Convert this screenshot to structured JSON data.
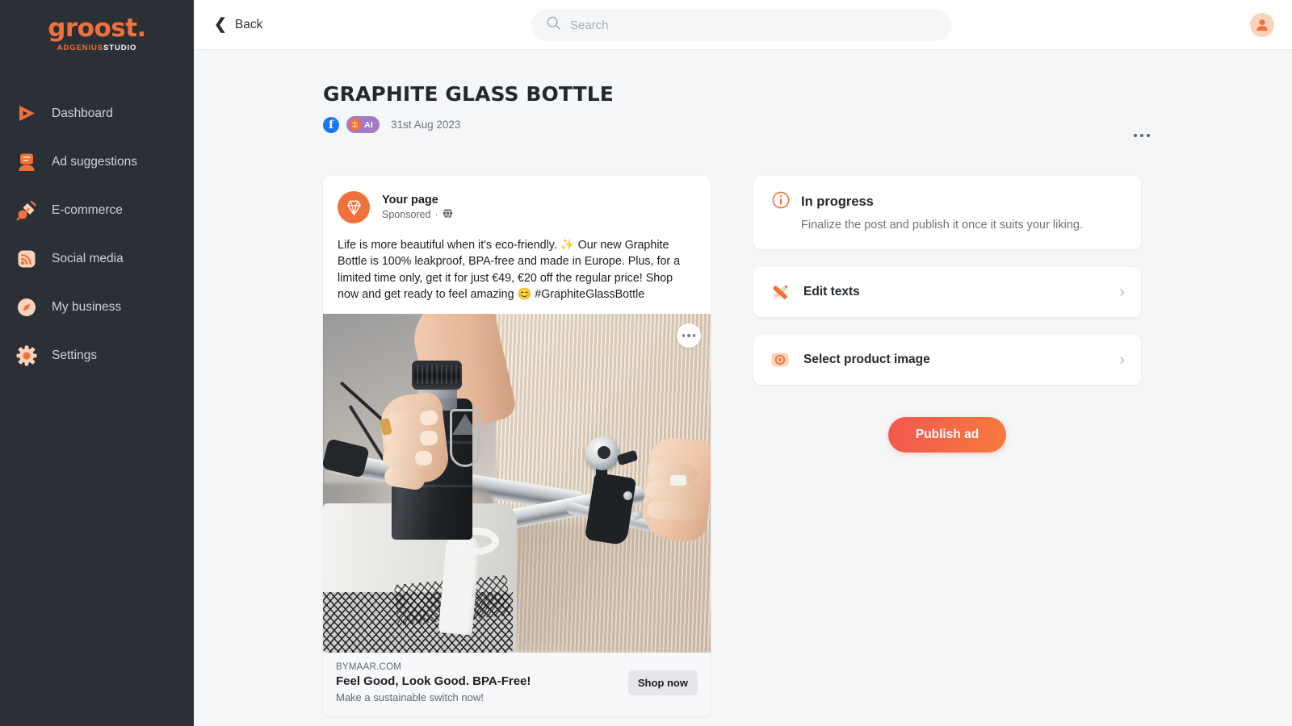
{
  "brand": {
    "logo_word": "groost.",
    "logo_sub_orange": "ADGENIUS",
    "logo_sub_white": "STUDIO"
  },
  "colors": {
    "accent": "#f2713a",
    "sidebar_bg": "#2b2f36",
    "page_bg": "#f5f6f8",
    "publish_gradient_start": "#f2584f",
    "publish_gradient_end": "#f87a3c",
    "ai_badge_bg": "#a27bc4",
    "facebook_blue": "#1877f2",
    "shop_btn_bg": "#e4e6eb"
  },
  "sidebar": {
    "items": [
      {
        "label": "Dashboard",
        "icon": "play-triangle-icon"
      },
      {
        "label": "Ad suggestions",
        "icon": "ad-card-icon"
      },
      {
        "label": "E-commerce",
        "icon": "plug-icon"
      },
      {
        "label": "Social media",
        "icon": "rss-icon"
      },
      {
        "label": "My business",
        "icon": "compass-icon"
      },
      {
        "label": "Settings",
        "icon": "gear-icon"
      }
    ]
  },
  "topbar": {
    "back_label": "Back",
    "back_icon": "chevron-left-icon",
    "search_placeholder": "Search",
    "search_value": "",
    "search_icon": "search-icon",
    "avatar_icon": "user-avatar-icon"
  },
  "page": {
    "title": "GRAPHITE GLASS BOTTLE",
    "platform_badge": "f",
    "platform_name": "facebook-icon",
    "ai_badge_label": "AI",
    "ai_badge_icon": "brain-icon",
    "date": "31st Aug 2023",
    "overflow_menu_icon": "more-horizontal-icon"
  },
  "post": {
    "page_name": "Your page",
    "sponsored": "Sponsored",
    "separator": "·",
    "audience_icon": "globe-icon",
    "avatar_icon": "diamond-icon",
    "body": "Life is more beautiful when it's eco-friendly. ✨ Our new Graphite Bottle is 100% leakproof, BPA-free and made in Europe. Plus, for a limited time only, get it for just €49, €20 off the regular price! Shop now and get ready to feel amazing 😊 #GraphiteGlassBottle",
    "image_alt": "Woman placing a black graphite glass bottle into a white bicycle basket",
    "image_menu_icon": "more-horizontal-icon",
    "link_domain": "BYMAAR.COM",
    "link_title": "Feel Good, Look Good. BPA-Free!",
    "link_description": "Make a sustainable switch now!",
    "cta_label": "Shop now"
  },
  "status": {
    "icon": "info-circle-icon",
    "title": "In progress",
    "description": "Finalize the post and publish it once it suits your liking."
  },
  "actions": [
    {
      "label": "Edit texts",
      "icon": "pencil-cross-icon",
      "chevron": "chevron-right-icon"
    },
    {
      "label": "Select product image",
      "icon": "image-target-icon",
      "chevron": "chevron-right-icon"
    }
  ],
  "publish": {
    "label": "Publish ad"
  }
}
